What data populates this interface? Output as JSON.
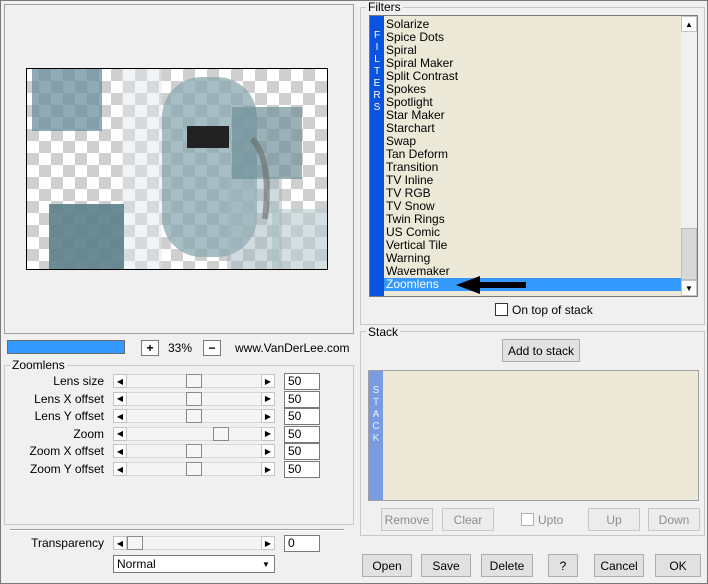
{
  "preview": {
    "zoom_minus": "+",
    "zoom_plus": "−",
    "zoom_value": "33%",
    "progress_fraction": 1.0,
    "website": "www.VanDerLee.com"
  },
  "zoomlens": {
    "title": "Zoomlens",
    "params": [
      {
        "label": "Lens size",
        "value": "50",
        "slider_fraction": 0.5
      },
      {
        "label": "Lens X offset",
        "value": "50",
        "slider_fraction": 0.5
      },
      {
        "label": "Lens Y offset",
        "value": "50",
        "slider_fraction": 0.5
      },
      {
        "label": "Zoom",
        "value": "50",
        "slider_fraction": 0.73
      },
      {
        "label": "Zoom X offset",
        "value": "50",
        "slider_fraction": 0.5
      },
      {
        "label": "Zoom Y offset",
        "value": "50",
        "slider_fraction": 0.5
      }
    ]
  },
  "transparency": {
    "label": "Transparency",
    "value": "0",
    "slider_fraction": 0.0,
    "blend_mode": "Normal"
  },
  "filters": {
    "title": "Filters",
    "strip_label": "FILTERS",
    "items": [
      "Solarize",
      "Spice Dots",
      "Spiral",
      "Spiral Maker",
      "Split Contrast",
      "Spokes",
      "Spotlight",
      "Star Maker",
      "Starchart",
      "Swap",
      "Tan Deform",
      "Transition",
      "TV Inline",
      "TV RGB",
      "TV Snow",
      "Twin Rings",
      "US Comic",
      "Vertical Tile",
      "Warning",
      "Wavemaker",
      "Zoomlens"
    ],
    "selected": "Zoomlens",
    "selection_color": "#3399ff",
    "on_top_label": "On top of stack",
    "on_top_checked": false
  },
  "stack": {
    "title": "Stack",
    "strip_label": "STACK",
    "add_label": "Add to stack",
    "remove_label": "Remove",
    "clear_label": "Clear",
    "upto_label": "Upto",
    "up_label": "Up",
    "down_label": "Down"
  },
  "footer": {
    "open": "Open",
    "save": "Save",
    "delete": "Delete",
    "help": "?",
    "cancel": "Cancel",
    "ok": "OK"
  },
  "colors": {
    "filter_strip": "#0a52e0",
    "stack_strip": "#7b9be0",
    "list_bg": "#ece9d8",
    "accent": "#3399ff"
  }
}
